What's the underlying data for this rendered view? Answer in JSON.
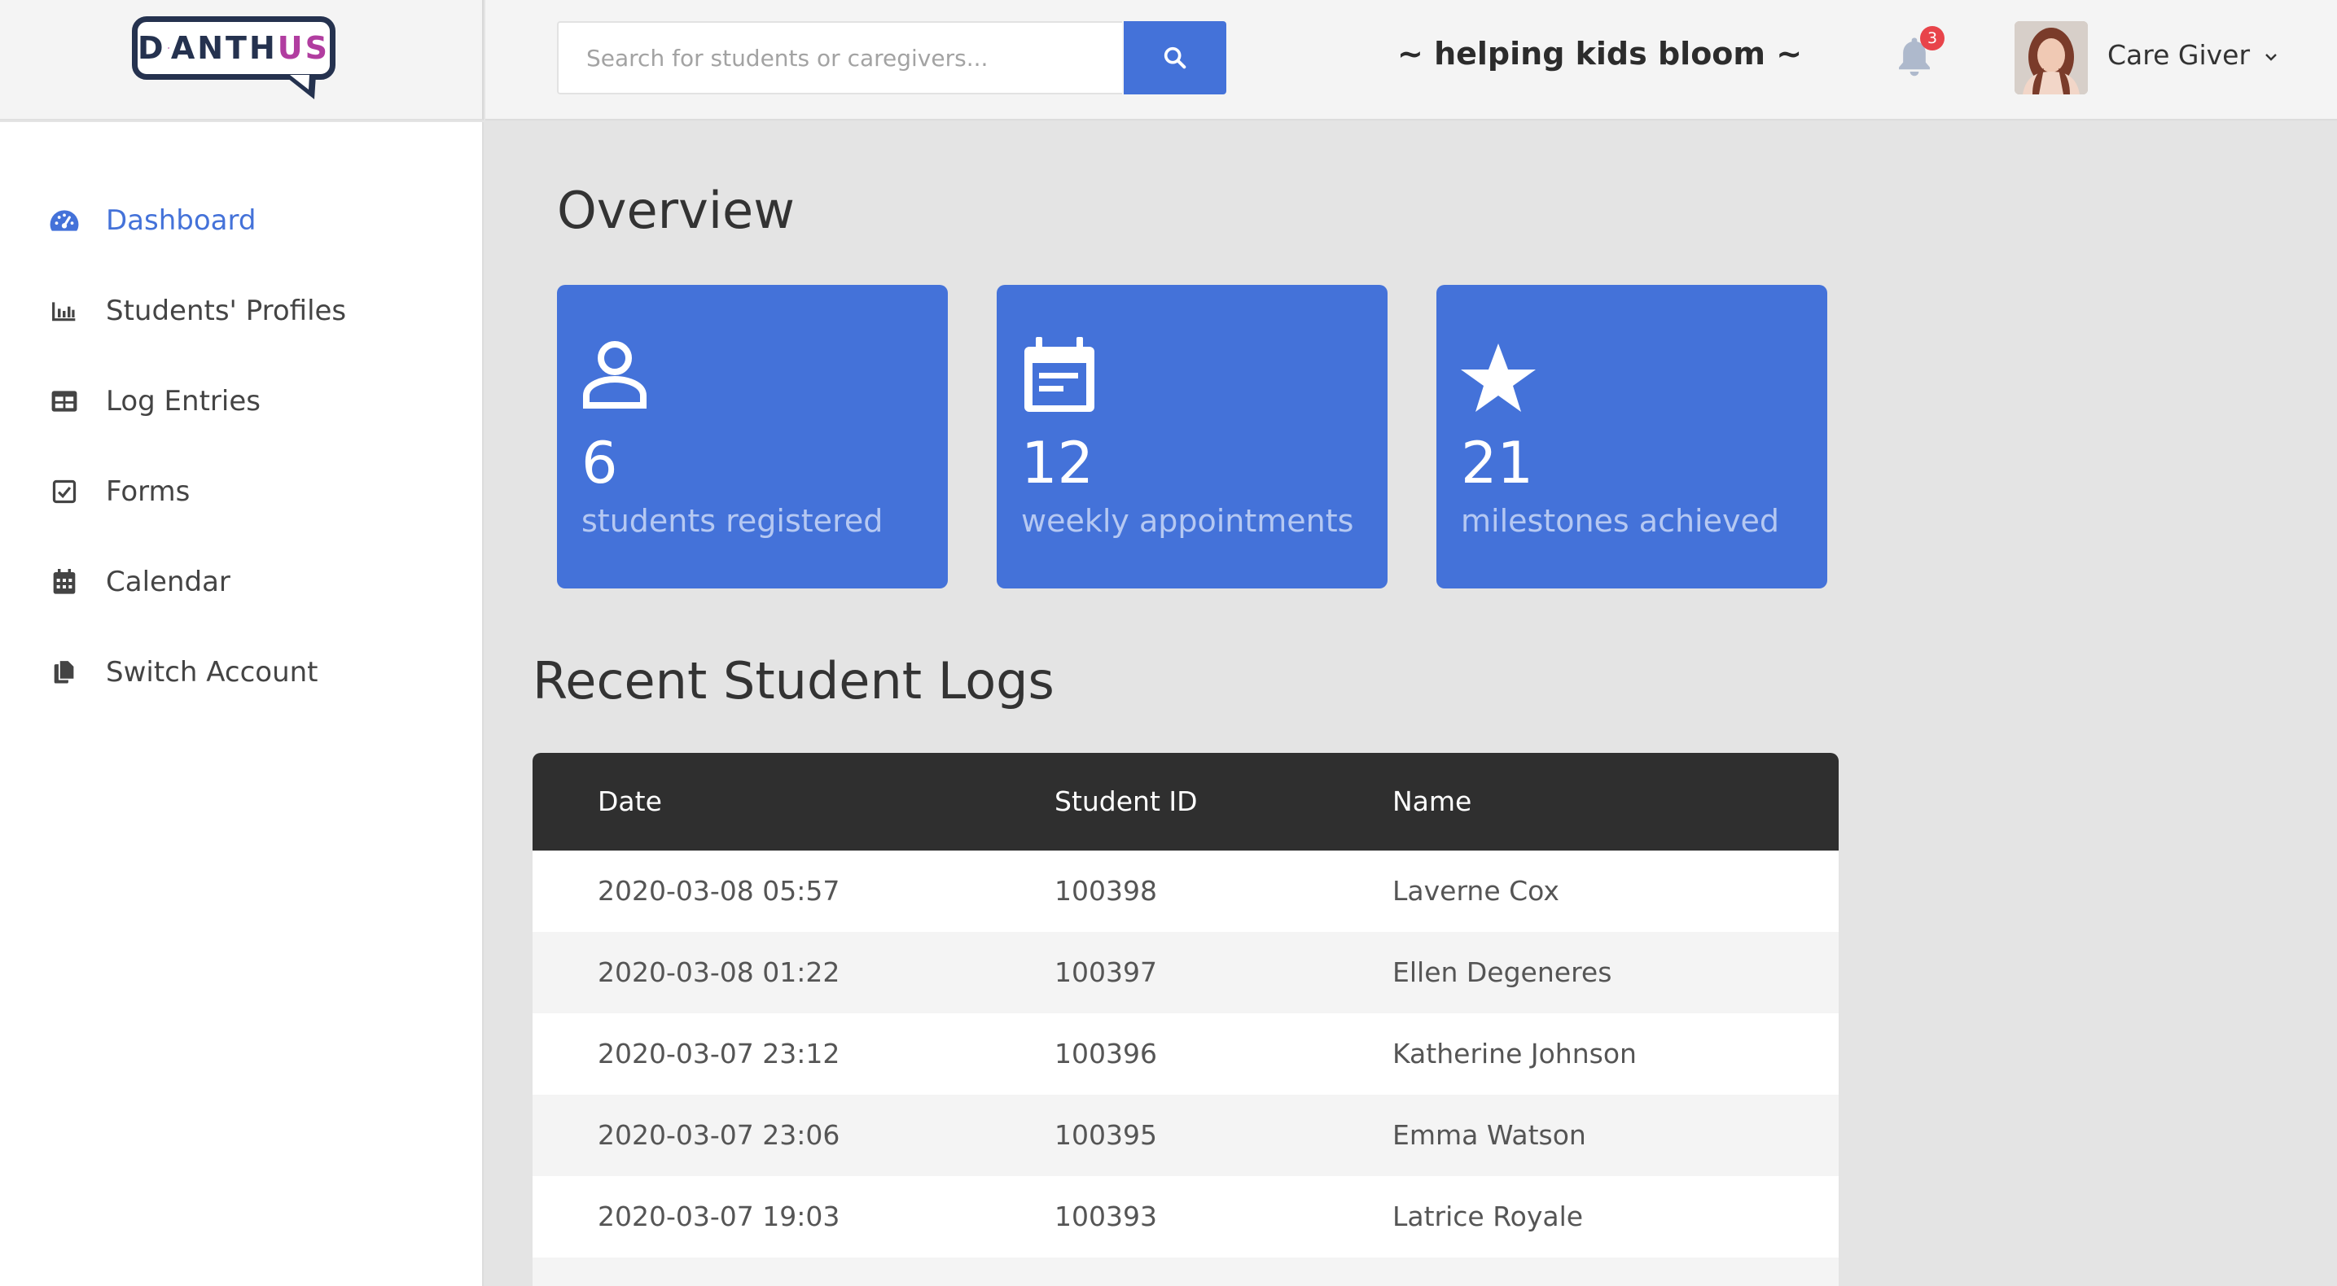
{
  "brand": {
    "logo_text_a": "D",
    "logo_text_b": "ANTH",
    "logo_text_c": "US",
    "tagline": "~ helping kids bloom ~"
  },
  "search": {
    "placeholder": "Search for students or caregivers..."
  },
  "header": {
    "notification_count": "3",
    "user_name": "Care Giver"
  },
  "sidebar": {
    "items": [
      {
        "label": "Dashboard",
        "icon": "dashboard-gauge-icon",
        "active": true
      },
      {
        "label": "Students' Profiles",
        "icon": "bar-chart-icon"
      },
      {
        "label": "Log Entries",
        "icon": "table-icon"
      },
      {
        "label": "Forms",
        "icon": "checkbox-icon"
      },
      {
        "label": "Calendar",
        "icon": "calendar-icon"
      },
      {
        "label": "Switch Account",
        "icon": "copy-files-icon"
      }
    ]
  },
  "overview": {
    "title": "Overview",
    "cards": [
      {
        "value": "6",
        "caption": "students registered",
        "icon": "person-icon"
      },
      {
        "value": "12",
        "caption": "weekly appointments",
        "icon": "calendar-note-icon"
      },
      {
        "value": "21",
        "caption": "milestones achieved",
        "icon": "star-icon"
      }
    ]
  },
  "logs": {
    "title": "Recent Student Logs",
    "columns": [
      "Date",
      "Student ID",
      "Name"
    ],
    "rows": [
      {
        "date": "2020-03-08 05:57",
        "id": "100398",
        "name": "Laverne Cox"
      },
      {
        "date": "2020-03-08 01:22",
        "id": "100397",
        "name": "Ellen Degeneres"
      },
      {
        "date": "2020-03-07 23:12",
        "id": "100396",
        "name": "Katherine Johnson"
      },
      {
        "date": "2020-03-07 23:06",
        "id": "100395",
        "name": "Emma Watson"
      },
      {
        "date": "2020-03-07 19:03",
        "id": "100393",
        "name": "Latrice Royale"
      }
    ]
  },
  "colors": {
    "accent": "#4472d9",
    "sidebar_bg": "#ffffff",
    "main_bg": "#e4e4e4",
    "table_header": "#2f2f2f",
    "badge": "#e8444a"
  }
}
